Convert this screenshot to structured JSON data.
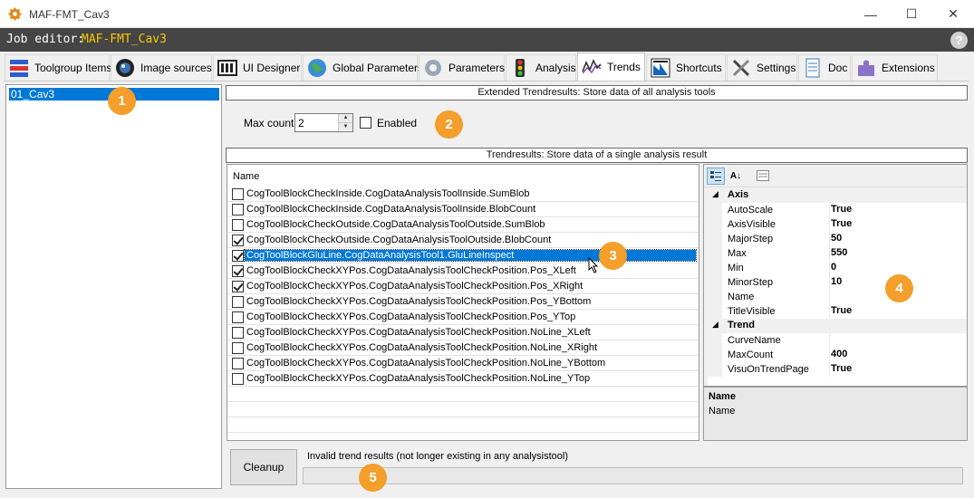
{
  "window": {
    "title": "MAF-FMT_Cav3",
    "minimize_glyph": "—",
    "maximize_glyph": "☐",
    "close_glyph": "✕"
  },
  "job_bar": {
    "label": "Job editor:",
    "job_name": "MAF-FMT_Cav3",
    "help_glyph": "?"
  },
  "tabs": [
    {
      "label": "Toolgroup Items",
      "icon": "toolgroup-icon"
    },
    {
      "label": "Image sources",
      "icon": "camera-lens-icon"
    },
    {
      "label": "UI Designer",
      "icon": "ui-designer-icon"
    },
    {
      "label": "Global Parameters",
      "icon": "globe-icon"
    },
    {
      "label": "Parameters",
      "icon": "gear-icon"
    },
    {
      "label": "Analysis",
      "icon": "traffic-light-icon"
    },
    {
      "label": "Trends",
      "icon": "trend-line-icon",
      "active": true
    },
    {
      "label": "Shortcuts",
      "icon": "shortcuts-icon"
    },
    {
      "label": "Settings",
      "icon": "tools-icon"
    },
    {
      "label": "Doc",
      "icon": "document-icon"
    },
    {
      "label": "Extensions",
      "icon": "puzzle-icon"
    }
  ],
  "tree": {
    "items": [
      "01_Cav3"
    ]
  },
  "extended": {
    "header": "Extended Trendresults: Store data of all analysis tools",
    "max_count_label": "Max count",
    "max_count_value": "2",
    "enabled_label": "Enabled",
    "enabled": false
  },
  "trend": {
    "header": "Trendresults: Store data of a single analysis result",
    "list_column": "Name",
    "rows": [
      {
        "label": "CogToolBlockCheckInside.CogDataAnalysisToolInside.SumBlob",
        "checked": false
      },
      {
        "label": "CogToolBlockCheckInside.CogDataAnalysisToolInside.BlobCount",
        "checked": false
      },
      {
        "label": "CogToolBlockCheckOutside.CogDataAnalysisToolOutside.SumBlob",
        "checked": false
      },
      {
        "label": "CogToolBlockCheckOutside.CogDataAnalysisToolOutside.BlobCount",
        "checked": true
      },
      {
        "label": "CogToolBlockGluLine.CogDataAnalysisTool1.GluLineInspect",
        "checked": true,
        "selected": true
      },
      {
        "label": "CogToolBlockCheckXYPos.CogDataAnalysisToolCheckPosition.Pos_XLeft",
        "checked": true
      },
      {
        "label": "CogToolBlockCheckXYPos.CogDataAnalysisToolCheckPosition.Pos_XRight",
        "checked": true
      },
      {
        "label": "CogToolBlockCheckXYPos.CogDataAnalysisToolCheckPosition.Pos_YBottom",
        "checked": false
      },
      {
        "label": "CogToolBlockCheckXYPos.CogDataAnalysisToolCheckPosition.Pos_YTop",
        "checked": false
      },
      {
        "label": "CogToolBlockCheckXYPos.CogDataAnalysisToolCheckPosition.NoLine_XLeft",
        "checked": false
      },
      {
        "label": "CogToolBlockCheckXYPos.CogDataAnalysisToolCheckPosition.NoLine_XRight",
        "checked": false
      },
      {
        "label": "CogToolBlockCheckXYPos.CogDataAnalysisToolCheckPosition.NoLine_YBottom",
        "checked": false
      },
      {
        "label": "CogToolBlockCheckXYPos.CogDataAnalysisToolCheckPosition.NoLine_YTop",
        "checked": false
      }
    ]
  },
  "properties": {
    "toolbar": [
      "categorized-icon",
      "alphabetical-icon",
      "property-pages-icon"
    ],
    "categories": [
      {
        "name": "Axis",
        "props": [
          {
            "name": "AutoScale",
            "value": "True"
          },
          {
            "name": "AxisVisible",
            "value": "True"
          },
          {
            "name": "MajorStep",
            "value": "50"
          },
          {
            "name": "Max",
            "value": "550"
          },
          {
            "name": "Min",
            "value": "0"
          },
          {
            "name": "MinorStep",
            "value": "10"
          },
          {
            "name": "Name",
            "value": ""
          },
          {
            "name": "TitleVisible",
            "value": "True"
          }
        ]
      },
      {
        "name": "Trend",
        "props": [
          {
            "name": "CurveName",
            "value": ""
          },
          {
            "name": "MaxCount",
            "value": "400"
          },
          {
            "name": "VisuOnTrendPage",
            "value": "True"
          }
        ]
      }
    ],
    "description_title": "Name",
    "description_text": "Name"
  },
  "cleanup": {
    "button_label": "Cleanup",
    "invalid_label": "Invalid trend results (not longer existing in any analysistool)",
    "invalid_value": ""
  },
  "badges": [
    "1",
    "2",
    "3",
    "4",
    "5"
  ],
  "colors": {
    "accent": "#0078d7",
    "badge": "#f49e2b",
    "job_name": "#f7c800",
    "job_bar": "#454545"
  }
}
